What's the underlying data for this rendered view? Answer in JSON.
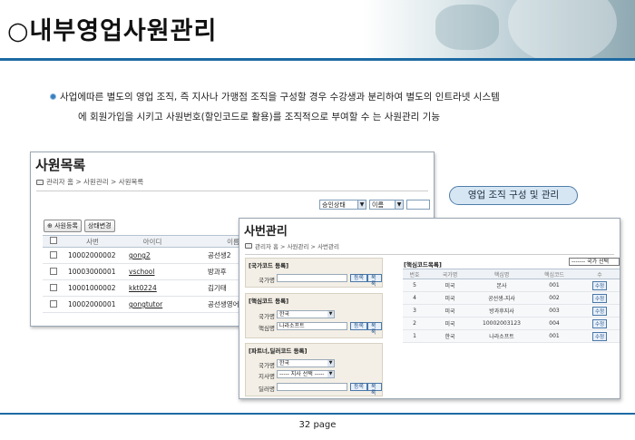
{
  "slide": {
    "title": "○내부영업사원관리",
    "bullet_line1": "사업에따른 별도의 영업 조직, 즉 지사나 가맹점 조직을 구성할 경우 수강생과 분리하여 별도의 인트라넷 시스템",
    "bullet_line2": "에 회원가입을 시키고 사원번호(할인코드로 활용)를 조직적으로 부여할 수 는 사원관리 기능",
    "callout": "영업 조직 구성 및 관리",
    "page": "32 page"
  },
  "win1": {
    "title": "사원목록",
    "breadcrumb": "관리자 홈 > 사원관리 > 사원목록",
    "filter_status": "승인상태",
    "filter_name": "이름",
    "btn_register": "사원등록",
    "btn_status": "상태변경",
    "columns": [
      "사번",
      "아이디",
      "이름"
    ],
    "rows": [
      {
        "no": "10002000002",
        "id": "gong2",
        "name": "공선생2"
      },
      {
        "no": "10003000001",
        "id": "vschool",
        "name": "방과후"
      },
      {
        "no": "10001000002",
        "id": "kkt0224",
        "name": "김기태"
      },
      {
        "no": "10002000001",
        "id": "gongtutor",
        "name": "공선생영어"
      }
    ]
  },
  "win2": {
    "title": "사번관리",
    "breadcrumb": "관리자 홈 > 사원관리 > 사번관리",
    "panel_country": {
      "title": "[국가코드 등록]",
      "label": "국가명",
      "btn1": "등록",
      "btn2": "목록"
    },
    "panel_core": {
      "title": "[핵심코드 등록]",
      "label1": "국가명",
      "value1": "한국",
      "label2": "핵심명",
      "value2": "나라소프트",
      "btn1": "등록",
      "btn2": "목록"
    },
    "panel_dealer": {
      "title": "[파트너,딜러코드 등록]",
      "label1": "국가명",
      "value1": "한국",
      "label2": "지사명",
      "value2": "----- 지사 선택 -----",
      "label3": "딜러명",
      "btn1": "등록",
      "btn2": "목록"
    },
    "list_title": "[핵심코드목록]",
    "list_select": "------- 국가 선택",
    "columns": [
      "번호",
      "국가명",
      "핵심명",
      "핵심코드",
      "수"
    ],
    "rows": [
      {
        "no": "5",
        "country": "미국",
        "name": "본사",
        "code": "001",
        "action": "수정"
      },
      {
        "no": "4",
        "country": "미국",
        "name": "공선생-지사",
        "code": "002",
        "action": "수정"
      },
      {
        "no": "3",
        "country": "미국",
        "name": "방과후지사",
        "code": "003",
        "action": "수정"
      },
      {
        "no": "2",
        "country": "미국",
        "name": "10002003123",
        "code": "004",
        "action": "수정"
      },
      {
        "no": "1",
        "country": "한국",
        "name": "나라소프트",
        "code": "001",
        "action": "수정"
      }
    ]
  }
}
